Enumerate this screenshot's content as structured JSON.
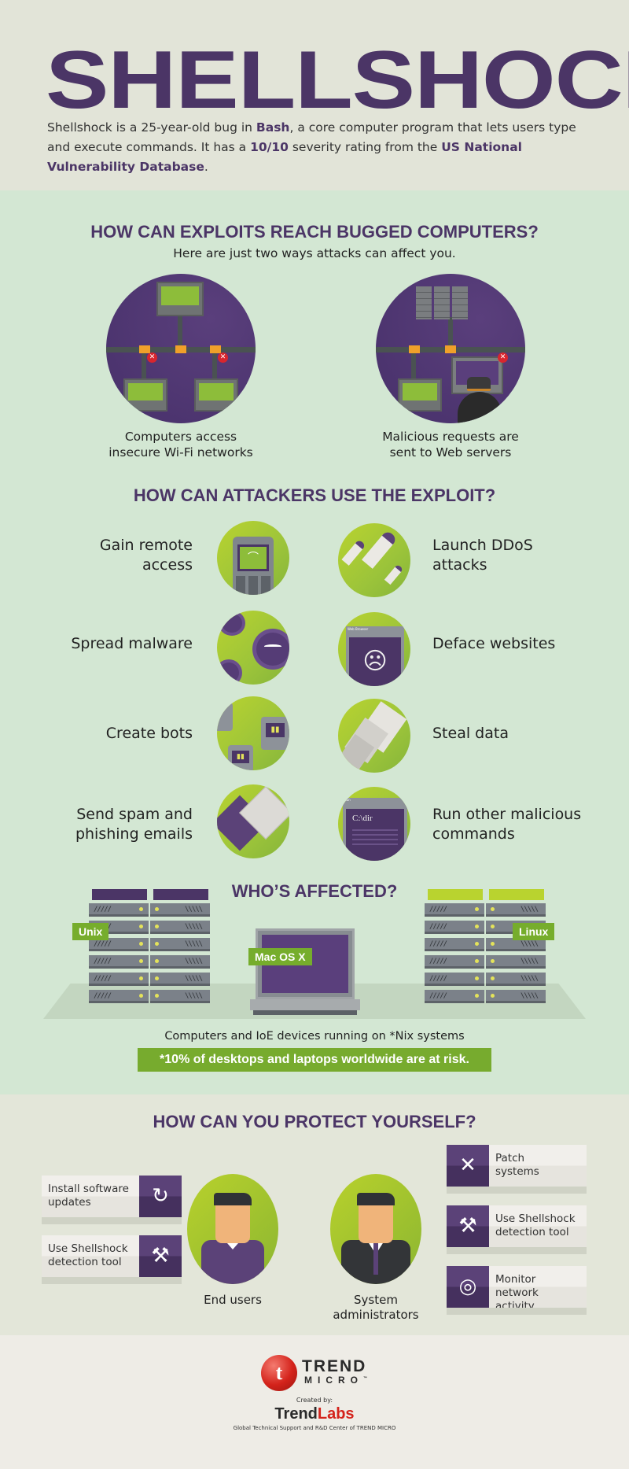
{
  "header": {
    "title": "SHELLSHOCK",
    "intro_parts": {
      "p1": "Shellshock is a 25-year-old bug in ",
      "bash": "Bash",
      "p2": ", a core computer program that lets users type and execute commands. It has a ",
      "rating": "10/10",
      "p3": " severity rating from the ",
      "nvd": "US National Vulnerability Database",
      "p4": "."
    }
  },
  "reach": {
    "heading": "HOW CAN EXPLOITS REACH BUGGED COMPUTERS?",
    "subheading": "Here are just two ways attacks can affect you.",
    "ways": [
      {
        "line1": "Computers access",
        "line2": "insecure Wi-Fi networks",
        "icon": "network-wifi-icon"
      },
      {
        "line1": "Malicious requests are",
        "line2": "sent to Web servers",
        "icon": "web-server-attack-icon"
      }
    ]
  },
  "uses": {
    "heading": "HOW CAN ATTACKERS USE THE EXPLOIT?",
    "left": [
      {
        "line1": "Gain remote",
        "line2": "access",
        "icon": "remote-access-icon"
      },
      {
        "line1": "Spread malware",
        "line2": "",
        "icon": "malware-icon"
      },
      {
        "line1": "Create bots",
        "line2": "",
        "icon": "bots-icon"
      },
      {
        "line1": "Send spam and",
        "line2": "phishing emails",
        "icon": "email-icon"
      }
    ],
    "right": [
      {
        "line1": "Launch DDoS",
        "line2": "attacks",
        "icon": "rockets-icon"
      },
      {
        "line1": "Deface websites",
        "line2": "",
        "icon": "angry-browser-icon"
      },
      {
        "line1": "Steal data",
        "line2": "",
        "icon": "documents-icon"
      },
      {
        "line1": "Run other malicious",
        "line2": "commands",
        "icon": "terminal-icon"
      }
    ],
    "browser_title": "Web Browser",
    "run_title": "Run",
    "command_text": "C:\\dir"
  },
  "affected": {
    "heading": "WHO’S AFFECTED?",
    "systems": [
      "Unix",
      "Mac OS X",
      "Linux"
    ],
    "note": "Computers and IoE devices running on *Nix systems",
    "risk": "*10% of desktops and laptops worldwide are at risk.",
    "vent_left": "/////",
    "vent_right": "\\\\\\\\\\"
  },
  "protect": {
    "heading": "HOW CAN YOU PROTECT YOURSELF?",
    "end_users": {
      "label": "End users",
      "tips": [
        {
          "line1": "Install software",
          "line2": "updates",
          "icon": "refresh-icon",
          "glyph": "↻"
        },
        {
          "line1": "Use Shellshock",
          "line2": "detection tool",
          "icon": "tools-icon",
          "glyph": "⚒"
        }
      ]
    },
    "admins": {
      "label1": "System",
      "label2": "administrators",
      "tips": [
        {
          "line1": "Patch",
          "line2": "systems",
          "icon": "bandage-icon",
          "glyph": "✕"
        },
        {
          "line1": "Use Shellshock",
          "line2": "detection tool",
          "icon": "tools-icon",
          "glyph": "⚒"
        },
        {
          "line1": "Monitor",
          "line2": "network activity",
          "icon": "globe-icon",
          "glyph": "◎"
        }
      ]
    }
  },
  "footer": {
    "brand_top": "TREND",
    "brand_bottom": "MICRO",
    "trademark": "™",
    "created_by": "Created by:",
    "lab_a": "Trend",
    "lab_b": "Labs",
    "tagline": "Global Technical Support and R&D Center of TREND MICRO",
    "logo_glyph": "t"
  },
  "colors": {
    "purple": "#4b3566",
    "green": "#77ab2e",
    "lime": "#b9d32f",
    "mint_bg": "#d3e7d3",
    "paper_bg": "#e2e4d8",
    "red": "#d4231b"
  }
}
